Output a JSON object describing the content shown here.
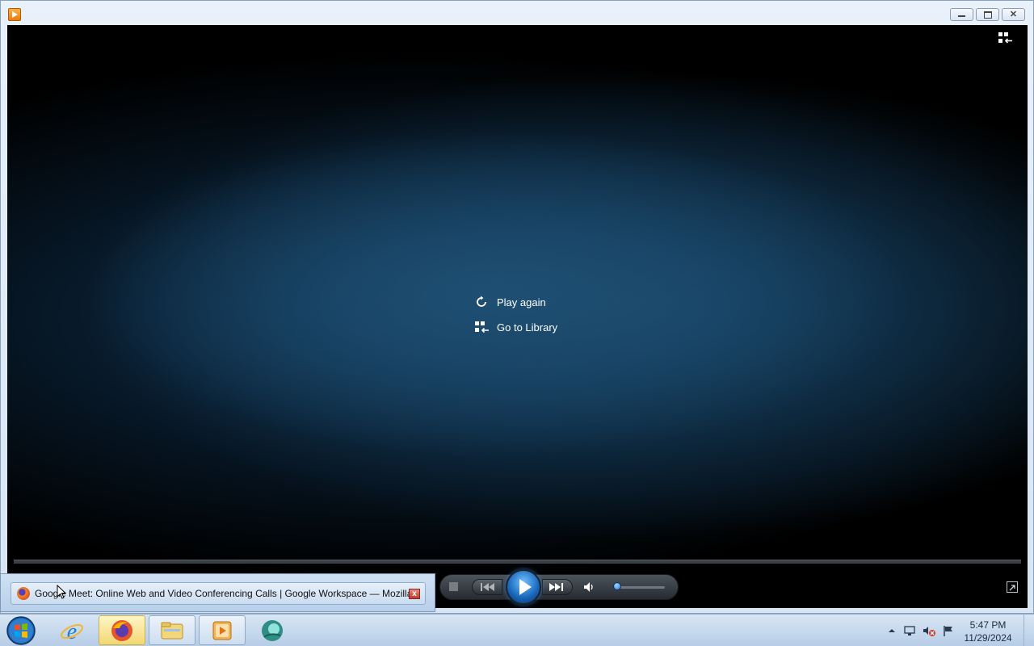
{
  "window": {
    "title_icon": "media-player-icon",
    "buttons": {
      "minimize": "minimize-icon",
      "restore": "restore-icon",
      "close": "close-icon"
    }
  },
  "player": {
    "menu": {
      "play_again": "Play again",
      "go_to_library": "Go to Library"
    },
    "controls": {
      "volume_level": 0.05
    }
  },
  "thumbnail": {
    "title": "Google Meet: Online Web and Video Conferencing Calls | Google Workspace — Mozilla..."
  },
  "taskbar": {
    "apps": [
      {
        "name": "internet-explorer-icon"
      },
      {
        "name": "firefox-icon"
      },
      {
        "name": "file-explorer-icon"
      },
      {
        "name": "windows-media-player-icon"
      },
      {
        "name": "app-icon"
      }
    ],
    "clock": {
      "time": "5:47 PM",
      "date": "11/29/2024"
    }
  },
  "colors": {
    "video_bg": "#000000",
    "accent_blue": "#1664b8",
    "taskbar_active": "#f2d873"
  }
}
